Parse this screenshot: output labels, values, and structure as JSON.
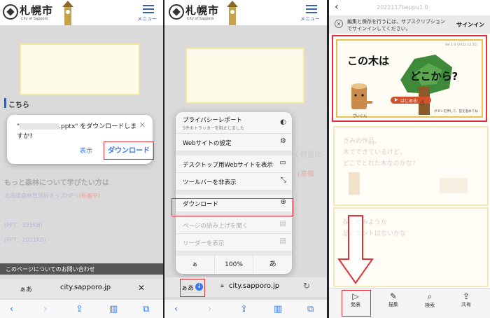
{
  "site": {
    "name": "札幌市",
    "sub": "City of Sapporo",
    "menu_label": "メニュー"
  },
  "panel1": {
    "section_heading": "こちら",
    "dialog_message_pre": "\"",
    "dialog_message_post": ".pptx\" をダウンロードしますか?",
    "cancel": "表示",
    "download": "ダウンロード",
    "more_learning": "もっと森林について学びたい方は",
    "link_line": "北海道森林管理局キッズHPへ",
    "link_badge": "(新着中)",
    "file_size_1": "(PPT：321KB)",
    "file_size_2": "(PPT：2021KB)",
    "inquiry": "このページについてのお問い合わせ",
    "aa": "ぁあ",
    "url": "city.sapporo.jp"
  },
  "panel2": {
    "menu_items": [
      {
        "label": "プライバシーレポート",
        "sub": "5件のトラッカーを阻止しました",
        "icon": "◐"
      },
      {
        "label": "Webサイトの設定",
        "icon": "⚙"
      },
      {
        "label": "デスクトップ用Webサイトを表示",
        "icon": "▭"
      },
      {
        "label": "ツールバーを非表示",
        "icon": "⤡"
      },
      {
        "label": "ダウンロード",
        "icon": "⊕"
      },
      {
        "label": "ページの読み上げを聞く",
        "icon": "▤"
      },
      {
        "label": "リーダーを表示",
        "icon": "▤"
      }
    ],
    "zoom_small": "ぁ",
    "zoom_value": "100%",
    "zoom_large": "あ",
    "aa": "ぁあ",
    "url": "city.sapporo.jp",
    "ghost_right": "く軽量化",
    "ghost_badge": "(準備"
  },
  "panel3": {
    "title": "2022117beppu1.0",
    "notice": "編集と保存を行うには、サブスクリプションでサインインしてください。",
    "signin": "サインイン",
    "slide_title_1": "この木は",
    "slide_title_2": "どこから?",
    "version": "Ver.1.0 (2022.12.21)",
    "start_button": "はじめる",
    "start_note": "ボタンを押して、話を進めてね",
    "character": "ざいくん",
    "slide2_lines": [
      "きみの作品、",
      "木でできているけど、",
      "どこでとれた木なのかな?"
    ],
    "slide3_lines": [
      "探してみようか",
      "品とヒントはないかな"
    ],
    "bottom_tabs": [
      {
        "label": "発表",
        "icon": "▷"
      },
      {
        "label": "描集",
        "icon": "✎"
      },
      {
        "label": "検索",
        "icon": "⌕"
      },
      {
        "label": "共有",
        "icon": "⇪"
      }
    ]
  }
}
